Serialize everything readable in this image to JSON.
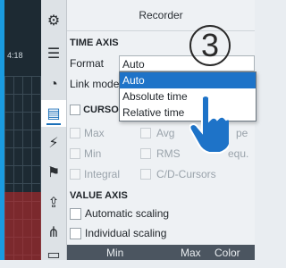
{
  "left_panel": {
    "timestamp": "4:18"
  },
  "toolbar": {
    "icons": [
      "gear-icon",
      "list-icon",
      "gauge-icon",
      "recorder-icon",
      "trigger-icon",
      "flag-icon",
      "export-icon",
      "tree-icon",
      "extra-icon"
    ]
  },
  "panel": {
    "title": "Recorder",
    "time_axis": {
      "heading": "TIME AXIS",
      "format_label": "Format",
      "format_value": "Auto",
      "link_mode_label": "Link mode",
      "options": [
        "Auto",
        "Absolute time",
        "Relative time"
      ],
      "selected_option": "Auto"
    },
    "cursor": {
      "heading": "CURSO",
      "items": [
        "Max",
        "Avg",
        "pe",
        "Min",
        "RMS",
        "equ.",
        "Integral",
        "C/D-Cursors"
      ]
    },
    "value_axis": {
      "heading": "VALUE AXIS",
      "automatic_scaling": "Automatic scaling",
      "individual_scaling": "Individual scaling"
    },
    "columns": [
      "Min",
      "Max",
      "Color"
    ]
  },
  "annotation": {
    "step": "3"
  },
  "colors": {
    "accent": "#1e73c8",
    "panel_bg": "#eef1f4",
    "header_bg": "#4b5560"
  }
}
